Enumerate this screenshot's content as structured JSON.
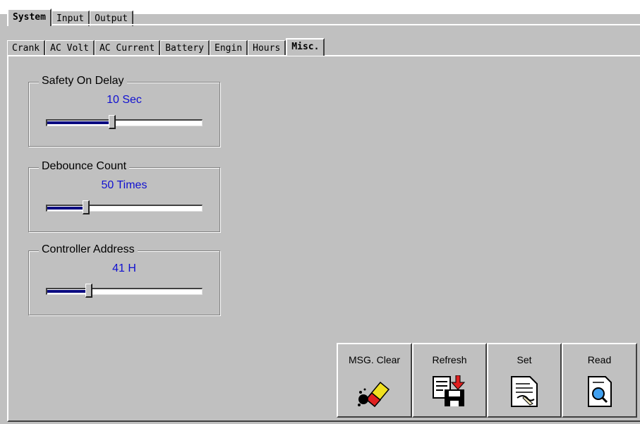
{
  "tabs_row1": [
    {
      "label": "System",
      "selected": true
    },
    {
      "label": "Input",
      "selected": false
    },
    {
      "label": "Output",
      "selected": false
    }
  ],
  "tabs_row2": [
    {
      "label": "Crank",
      "selected": false
    },
    {
      "label": "AC Volt",
      "selected": false
    },
    {
      "label": "AC Current",
      "selected": false
    },
    {
      "label": "Battery",
      "selected": false
    },
    {
      "label": "Engin",
      "selected": false
    },
    {
      "label": "Hours",
      "selected": false
    },
    {
      "label": "Misc.",
      "selected": true
    }
  ],
  "groups": [
    {
      "title": "Safety On Delay",
      "value": "10 Sec",
      "slider_fraction": 0.42
    },
    {
      "title": "Debounce Count",
      "value": "50 Times",
      "slider_fraction": 0.25
    },
    {
      "title": "Controller Address",
      "value": "41 H",
      "slider_fraction": 0.27
    }
  ],
  "buttons": {
    "msg_clear": {
      "label": "MSG. Clear",
      "icon": "eraser-icon"
    },
    "refresh": {
      "label": "Refresh",
      "icon": "save-to-disk-icon"
    },
    "set": {
      "label": "Set",
      "icon": "sign-document-icon"
    },
    "read": {
      "label": "Read",
      "icon": "document-magnifier-icon"
    }
  },
  "colors": {
    "background": "#c0c0c0",
    "value_text": "#1010d0",
    "slider_fill": "#0a0a80"
  }
}
